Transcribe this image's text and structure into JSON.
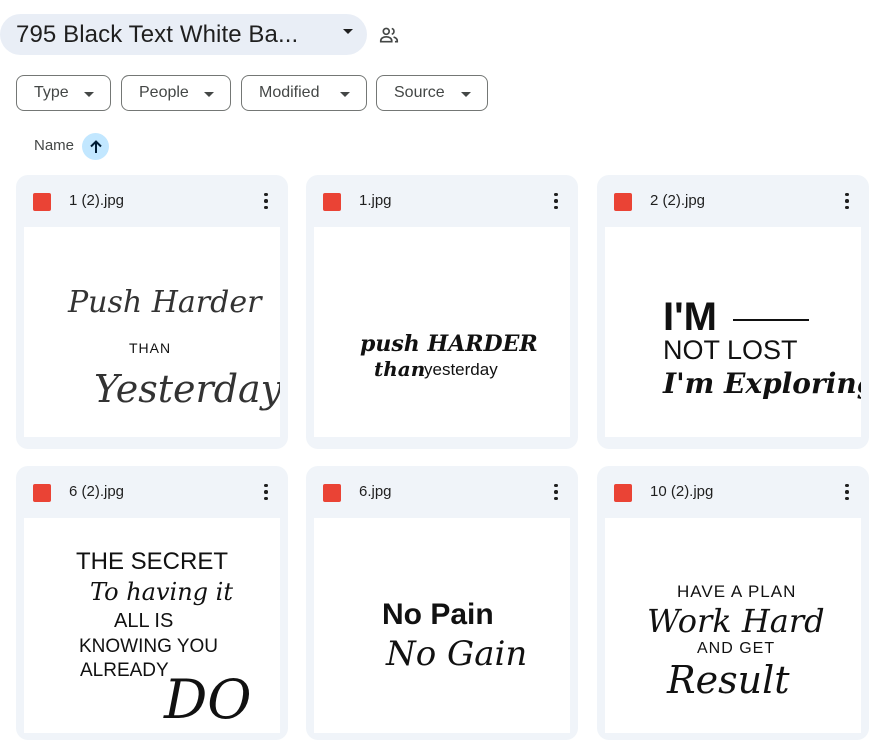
{
  "folder": {
    "title": "795 Black Text White Ba...",
    "share_icon": "shared-people-icon"
  },
  "filters": [
    {
      "label": "Type"
    },
    {
      "label": "People"
    },
    {
      "label": "Modified"
    },
    {
      "label": "Source"
    }
  ],
  "sort": {
    "label": "Name",
    "direction": "ascending"
  },
  "files": [
    {
      "name": "1 (2).jpg",
      "lines": [
        "Push Harder",
        "THAN",
        "Yesterday"
      ]
    },
    {
      "name": "1.jpg",
      "lines": [
        "push HARDER",
        "than",
        "yesterday"
      ]
    },
    {
      "name": "2 (2).jpg",
      "lines": [
        "I'M",
        "NOT LOST",
        "I'm Exploring"
      ]
    },
    {
      "name": "6 (2).jpg",
      "lines": [
        "THE SECRET",
        "To having it",
        "ALL IS",
        "KNOWING YOU",
        "ALREADY",
        "DO"
      ]
    },
    {
      "name": "6.jpg",
      "lines": [
        "No Pain",
        "No Gain"
      ]
    },
    {
      "name": "10 (2).jpg",
      "lines": [
        "HAVE A PLAN",
        "Work Hard",
        "AND GET",
        "Result"
      ]
    }
  ],
  "colors": {
    "chip_bg": "#e9eef6",
    "card_bg": "#f0f4f9",
    "image_icon": "#ea4335",
    "sort_bg": "#c2e7ff",
    "sort_arrow": "#001d35"
  }
}
